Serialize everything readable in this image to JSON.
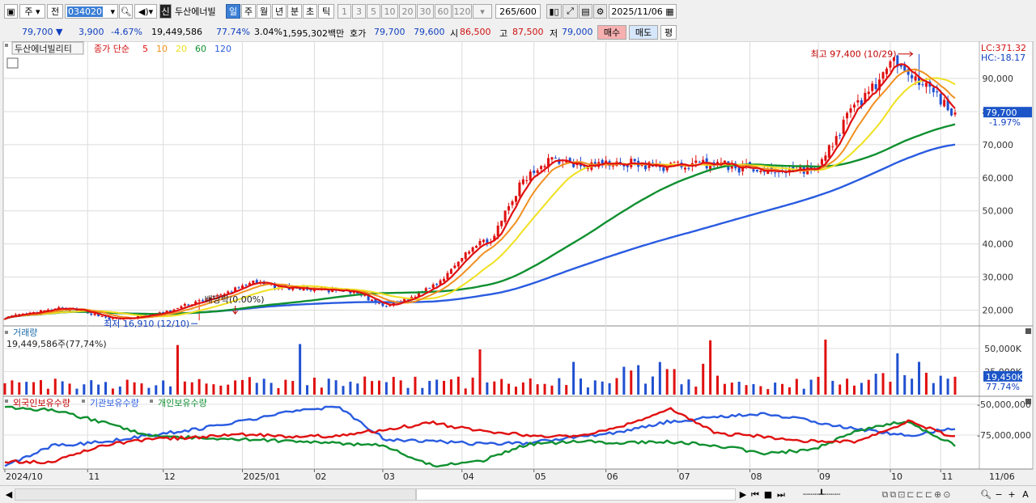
{
  "toolbar": {
    "mode_label": "주",
    "prev_label": "전",
    "code_value": "034020",
    "badge_new": "신",
    "stock_name": "두산에너빌",
    "periods": [
      "일",
      "주",
      "월",
      "년",
      "분",
      "초",
      "틱"
    ],
    "active_period": "일",
    "intervals": [
      "1",
      "3",
      "5",
      "10",
      "20",
      "30",
      "60",
      "120"
    ],
    "count_display": "265/600",
    "date_value": "2025/11/06"
  },
  "quote": {
    "price": "79,700",
    "change": "3,900",
    "change_pct": "-4.67%",
    "volume": "19,449,586",
    "vol_ratio": "77.74%",
    "turnover": "3.04%",
    "amount": "1,595,302백만",
    "bid_label": "호가",
    "ask": "79,700",
    "bid": "79,600",
    "open_label": "시",
    "open": "86,500",
    "high_label": "고",
    "high": "87,500",
    "low_label": "저",
    "low": "79,000",
    "buy_label": "매수",
    "sell_label": "매도",
    "avg_label": "평"
  },
  "price_panel": {
    "stock_tag": "두산에너빌리티",
    "ma_label": "종가 단순",
    "ma_periods": [
      "5",
      "10",
      "20",
      "60",
      "120"
    ],
    "ma_colors": [
      "#e01010",
      "#f09020",
      "#f0e020",
      "#109030",
      "#2a5ce0"
    ],
    "lc_label": "LC:371.32",
    "hc_label": "HC:-18.17",
    "high_annotation": "최고 97,400 (10/29)",
    "low_annotation": "최저 16,910 (12/10)",
    "div_annotation": "배당락(0.00%)",
    "last_price_label": "79,700",
    "last_change_label": "-1.97%"
  },
  "volume_panel": {
    "title": "거래량",
    "value_text": "19,449,586주(77,74%)",
    "last_label": "19,450K",
    "last_pct": "77.74%"
  },
  "holding_panel": {
    "series_labels": [
      "외국인보유수량",
      "기관보유수량",
      "개인보유수량"
    ],
    "series_colors": [
      "#2a5ce0",
      "#109030",
      "#e01010"
    ]
  },
  "chart_data": [
    {
      "type": "line",
      "title": "두산에너빌리티",
      "x": [
        "2024/10",
        "11",
        "12",
        "2025/01",
        "02",
        "03",
        "04",
        "05",
        "06",
        "07",
        "08",
        "09",
        "10",
        "11",
        "11/06"
      ],
      "yticks": [
        20000,
        30000,
        40000,
        50000,
        60000,
        70000,
        80000,
        90000
      ],
      "ylim": [
        15000,
        101000
      ],
      "close_approx": [
        17800,
        19000,
        20500,
        19500,
        17200,
        18000,
        19500,
        22500,
        24500,
        28500,
        27000,
        26500,
        26000,
        25000,
        21000,
        24000,
        28500,
        38000,
        42000,
        58000,
        66000,
        64500,
        64000,
        64500,
        63000,
        64000,
        64500,
        63000,
        62000,
        62500,
        63000,
        78000,
        88000,
        96000,
        86500,
        79700
      ],
      "ma_last": {
        "5": 86500,
        "10": 87000,
        "20": 80000,
        "60": 69000,
        "120": 62000
      },
      "high": 97400,
      "high_date": "10/29",
      "low": 16910,
      "low_date": "12/10",
      "last": 79700
    },
    {
      "type": "bar",
      "title": "거래량",
      "yticks": [
        25000000,
        50000000
      ],
      "ytick_labels": [
        "25,000K",
        "50,000K"
      ],
      "last": 19450000
    },
    {
      "type": "line",
      "title": "외국인보유수량 / 기관보유수량 / 개인보유수량",
      "yticks": [
        -50000000,
        -75000000
      ],
      "ytick_labels": [
        "-50,000,000",
        "-75,000,000"
      ]
    }
  ]
}
